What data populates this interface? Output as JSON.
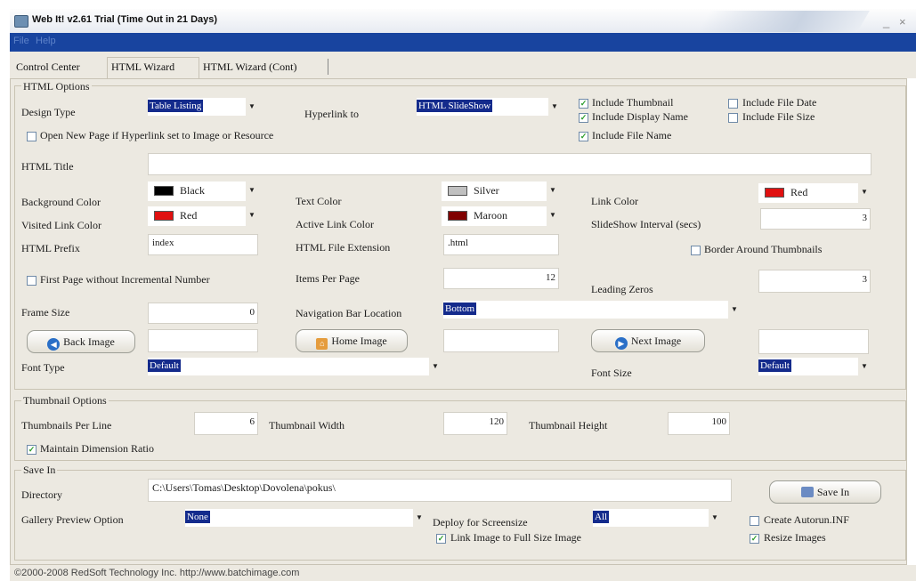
{
  "window": {
    "title": "Web It! v2.61 Trial (Time Out in 21 Days)",
    "minimize": "_",
    "close": "×"
  },
  "menu": [
    "File",
    "Help"
  ],
  "tabs": [
    "Control Center",
    "HTML Wizard",
    "HTML Wizard (Cont)"
  ],
  "html_options": {
    "legend": "HTML Options",
    "design_type_label": "Design Type",
    "design_type_value": "Table Listing",
    "hyperlink_to_label": "Hyperlink to",
    "hyperlink_to_value": "HTML SlideShow",
    "include_thumbnail": "Include Thumbnail",
    "include_display_name": "Include Display Name",
    "include_file_name": "Include File Name",
    "include_file_date": "Include File Date",
    "include_file_size": "Include File Size",
    "open_new_page": "Open New Page if Hyperlink set to Image or Resource",
    "html_title_label": "HTML Title",
    "html_title_value": "",
    "background_color_label": "Background Color",
    "background_color_value": "Black",
    "background_color_hex": "#000000",
    "text_color_label": "Text Color",
    "text_color_value": "Silver",
    "text_color_hex": "#c0c0c0",
    "link_color_label": "Link Color",
    "link_color_value": "Red",
    "link_color_hex": "#e01010",
    "visited_link_color_label": "Visited Link Color",
    "visited_link_color_value": "Red",
    "visited_link_color_hex": "#e01010",
    "active_link_color_label": "Active Link Color",
    "active_link_color_value": "Maroon",
    "active_link_color_hex": "#800000",
    "slideshow_interval_label": "SlideShow Interval (secs)",
    "slideshow_interval_value": "3",
    "html_prefix_label": "HTML Prefix",
    "html_prefix_value": "index",
    "html_file_extension_label": "HTML File Extension",
    "html_file_extension_value": ".html",
    "border_around_thumbnails": "Border Around Thumbnails",
    "first_page_without_number": "First Page without Incremental Number",
    "items_per_page_label": "Items Per Page",
    "items_per_page_value": "12",
    "leading_zeros_label": "Leading Zeros",
    "leading_zeros_value": "3",
    "frame_size_label": "Frame Size",
    "frame_size_value": "0",
    "navigation_bar_location_label": "Navigation Bar Location",
    "navigation_bar_location_value": "Bottom",
    "back_image_button": "Back Image",
    "back_image_value": "",
    "home_image_button": "Home Image",
    "home_image_value": "",
    "next_image_button": "Next Image",
    "next_image_value": "",
    "font_type_label": "Font Type",
    "font_type_value": "Default",
    "font_size_label": "Font Size",
    "font_size_value": "Default"
  },
  "thumbnail_options": {
    "legend": "Thumbnail Options",
    "per_line_label": "Thumbnails Per Line",
    "per_line_value": "6",
    "width_label": "Thumbnail Width",
    "width_value": "120",
    "height_label": "Thumbnail Height",
    "height_value": "100",
    "maintain_ratio": "Maintain Dimension Ratio"
  },
  "save_in": {
    "legend": "Save In",
    "directory_label": "Directory",
    "directory_value": "C:\\Users\\Tomas\\Desktop\\Dovolena\\pokus\\",
    "save_in_button": "Save In",
    "gallery_preview_label": "Gallery Preview Option",
    "gallery_preview_value": "None",
    "deploy_label": "Deploy for Screensize",
    "deploy_value": "All",
    "create_autorun": "Create Autorun.INF",
    "link_full_size": "Link Image to Full Size Image",
    "resize_images": "Resize Images"
  },
  "status": "©2000-2008 RedSoft Technology Inc. http://www.batchimage.com"
}
